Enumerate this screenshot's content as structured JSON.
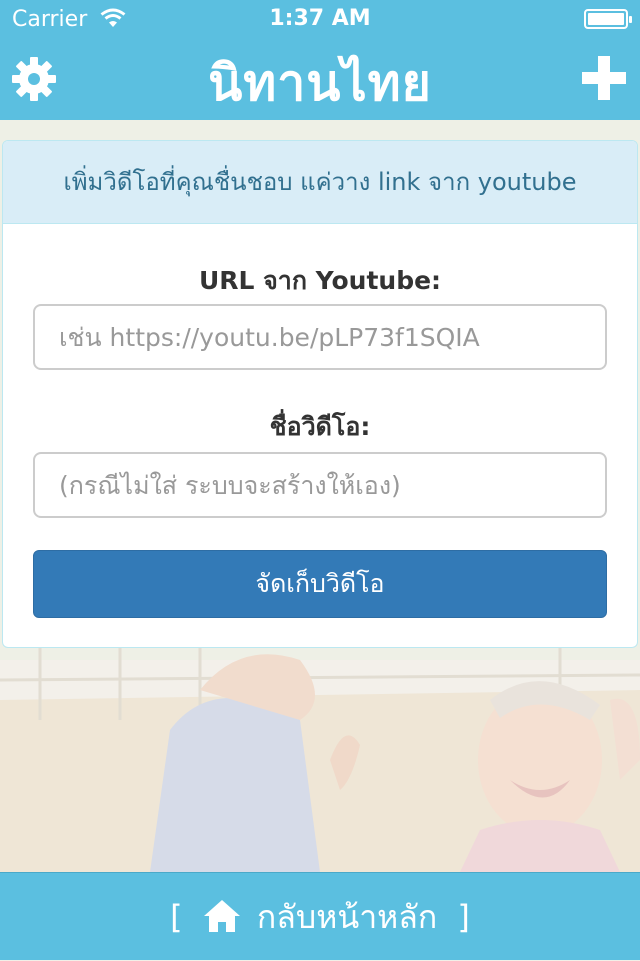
{
  "status_bar": {
    "carrier": "Carrier",
    "time": "1:37 AM"
  },
  "nav": {
    "title": "นิทานไทย",
    "left_icon": "gear-icon",
    "right_icon": "plus-icon"
  },
  "panel": {
    "heading": "เพิ่มวิดีโอที่คุณชื่นชอบ แค่วาง link จาก youtube",
    "url_label": "URL จาก Youtube:",
    "url_placeholder": "เช่น https://youtu.be/pLP73f1SQIA",
    "url_value": "",
    "name_label": "ชื่อวิดีโอ:",
    "name_placeholder": "(กรณีไม่ใส่ ระบบจะสร้างให้เอง)",
    "name_value": "",
    "save_label": "จัดเก็บวิดีโอ"
  },
  "footer": {
    "open_bracket": "[",
    "icon": "home-icon",
    "label": "กลับหน้าหลัก",
    "close_bracket": "]"
  },
  "colors": {
    "bar": "#5bbfe0",
    "panel_heading_bg": "#d9edf7",
    "panel_heading_text": "#31708f",
    "primary_button": "#337ab7"
  }
}
